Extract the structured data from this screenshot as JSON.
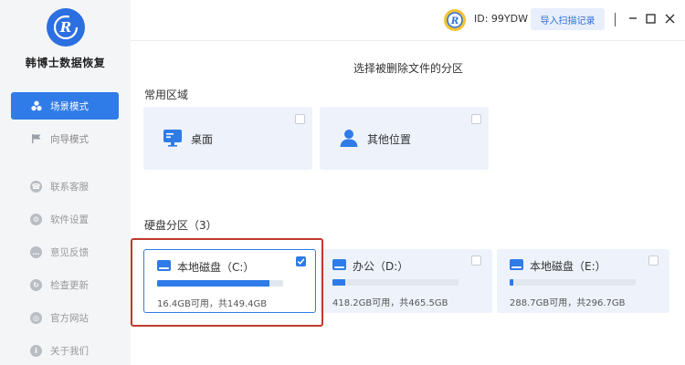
{
  "app": {
    "brand": "韩博士数据恢复",
    "user_id": "ID: 99YDW",
    "import_button": "导入扫描记录"
  },
  "nav": [
    {
      "label": "场景模式",
      "icon": "scenes-icon",
      "active": true
    },
    {
      "label": "向导模式",
      "icon": "flag-icon",
      "active": false
    }
  ],
  "utils": [
    {
      "label": "联系客服",
      "icon": "support-icon"
    },
    {
      "label": "软件设置",
      "icon": "settings-icon"
    },
    {
      "label": "意见反馈",
      "icon": "feedback-icon"
    },
    {
      "label": "检查更新",
      "icon": "update-icon"
    },
    {
      "label": "官方网站",
      "icon": "globe-icon"
    },
    {
      "label": "关于我们",
      "icon": "about-icon"
    }
  ],
  "main": {
    "title": "选择被删除文件的分区",
    "common_section": "常用区域",
    "common_areas": [
      {
        "label": "桌面",
        "icon": "desktop-icon",
        "checked": false
      },
      {
        "label": "其他位置",
        "icon": "user-icon",
        "checked": false
      }
    ],
    "disk_section": "硬盘分区（3）",
    "disks": [
      {
        "name": "本地磁盘（C:）",
        "capacity": "16.4GB可用，共149.4GB",
        "used_fraction": 0.89,
        "checked": true
      },
      {
        "name": "办公（D:）",
        "capacity": "418.2GB可用，共465.5GB",
        "used_fraction": 0.1,
        "checked": false
      },
      {
        "name": "本地磁盘（E:）",
        "capacity": "288.7GB可用，共296.7GB",
        "used_fraction": 0.03,
        "checked": false
      }
    ]
  },
  "colors": {
    "accent": "#2f7be8",
    "highlight": "#c0392b",
    "sidebar": "#f4f5f7",
    "card": "#eef3fb"
  }
}
